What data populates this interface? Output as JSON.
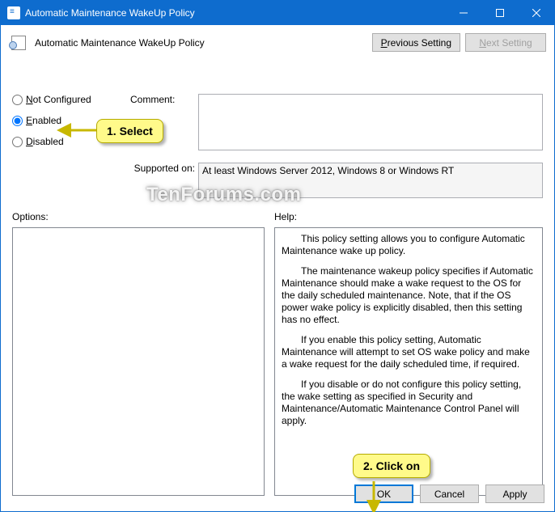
{
  "title": "Automatic Maintenance WakeUp Policy",
  "policy_name": "Automatic Maintenance WakeUp Policy",
  "nav": {
    "prev_prefix": "P",
    "prev_rest": "revious Setting",
    "next_prefix": "N",
    "next_rest": "ext Setting"
  },
  "radios": {
    "not_configured": {
      "rest": "ot Configured",
      "u": "N"
    },
    "enabled": {
      "rest": "nabled",
      "u": "E"
    },
    "disabled": {
      "rest": "isabled",
      "u": "D"
    },
    "selected": "enabled"
  },
  "labels": {
    "comment": "Comment:",
    "supported": "Supported on:",
    "options": "Options:",
    "help": "Help:"
  },
  "comment_text": "",
  "supported_text": "At least Windows Server 2012, Windows 8 or Windows RT",
  "help": {
    "p1": "This policy setting allows you to configure Automatic Maintenance wake up policy.",
    "p2": "The maintenance wakeup policy specifies if Automatic Maintenance should make a wake request to the OS for the daily scheduled maintenance. Note, that if the OS power wake policy is explicitly disabled, then this setting has no effect.",
    "p3": "If you enable this policy setting, Automatic Maintenance will attempt to set OS wake policy and make a wake request for the daily scheduled time, if required.",
    "p4": "If you disable or do not configure this policy setting, the wake setting as specified in Security and Maintenance/Automatic Maintenance Control Panel will apply."
  },
  "buttons": {
    "ok": "OK",
    "cancel": "Cancel",
    "apply": "Apply"
  },
  "callouts": {
    "select": "1. Select",
    "click": "2. Click on"
  },
  "watermark": "TenForums.com"
}
